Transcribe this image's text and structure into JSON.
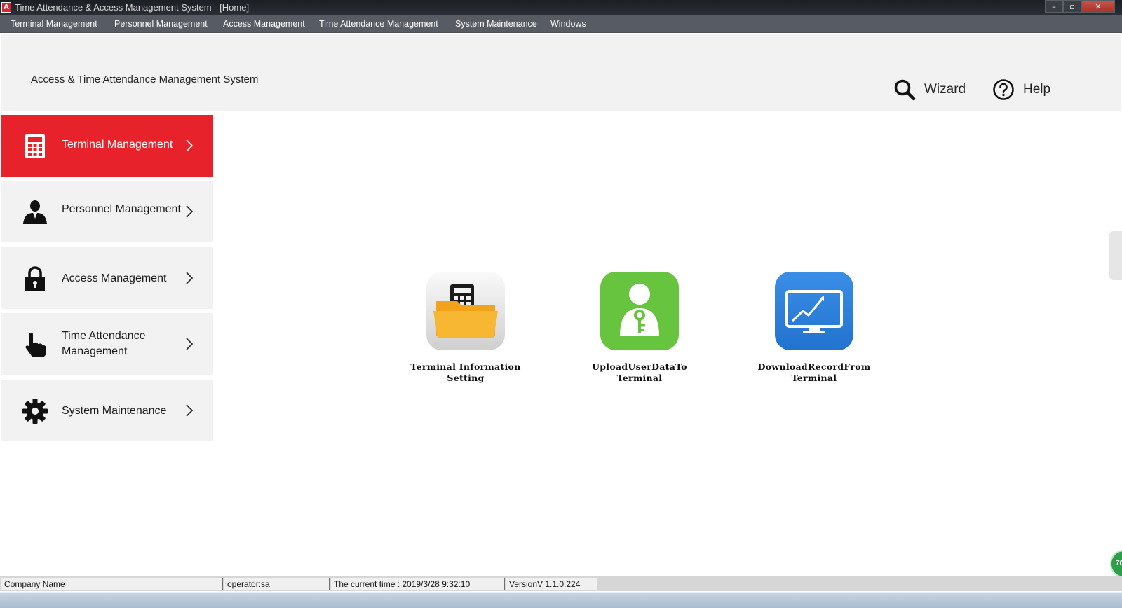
{
  "window": {
    "app_icon_letter": "A",
    "title": "Time Attendance & Access Management System - [Home]",
    "controls": {
      "minimize": "–",
      "restore": "▫",
      "close": "✕"
    }
  },
  "menubar": {
    "items": [
      "Terminal Management",
      "Personnel Management",
      "Access Management",
      "Time Attendance Management",
      "System Maintenance",
      "Windows"
    ]
  },
  "header": {
    "title": "Access & Time Attendance Management System",
    "wizard_label": "Wizard",
    "help_label": "Help"
  },
  "sidebar": {
    "items": [
      {
        "label": "Terminal Management",
        "icon": "calculator-icon",
        "active": true
      },
      {
        "label": "Personnel Management",
        "icon": "person-icon",
        "active": false
      },
      {
        "label": "Access Management",
        "icon": "lock-icon",
        "active": false
      },
      {
        "label_line1": "Time Attendance",
        "label_line2": "Management",
        "icon": "hand-pointer-icon",
        "active": false
      },
      {
        "label": "System Maintenance",
        "icon": "gear-icon",
        "active": false
      }
    ]
  },
  "tiles": [
    {
      "label": "Terminal Information\nSetting",
      "icon": "terminal-folder-icon"
    },
    {
      "label": "UploadUserDataTo\nTerminal",
      "icon": "user-key-icon"
    },
    {
      "label": "DownloadRecordFrom\nTerminal",
      "icon": "monitor-chart-icon"
    }
  ],
  "statusbar": {
    "company": "Company Name",
    "operator": "operator:sa",
    "time": "The current time : 2019/3/28 9:32:10",
    "version": "VersionV 1.1.0.224"
  },
  "badge_text": "70",
  "colors": {
    "accent_red": "#e8222a",
    "menubar": "#575b63",
    "tile_green": "#66c43f",
    "tile_blue": "#2f7fd8"
  }
}
